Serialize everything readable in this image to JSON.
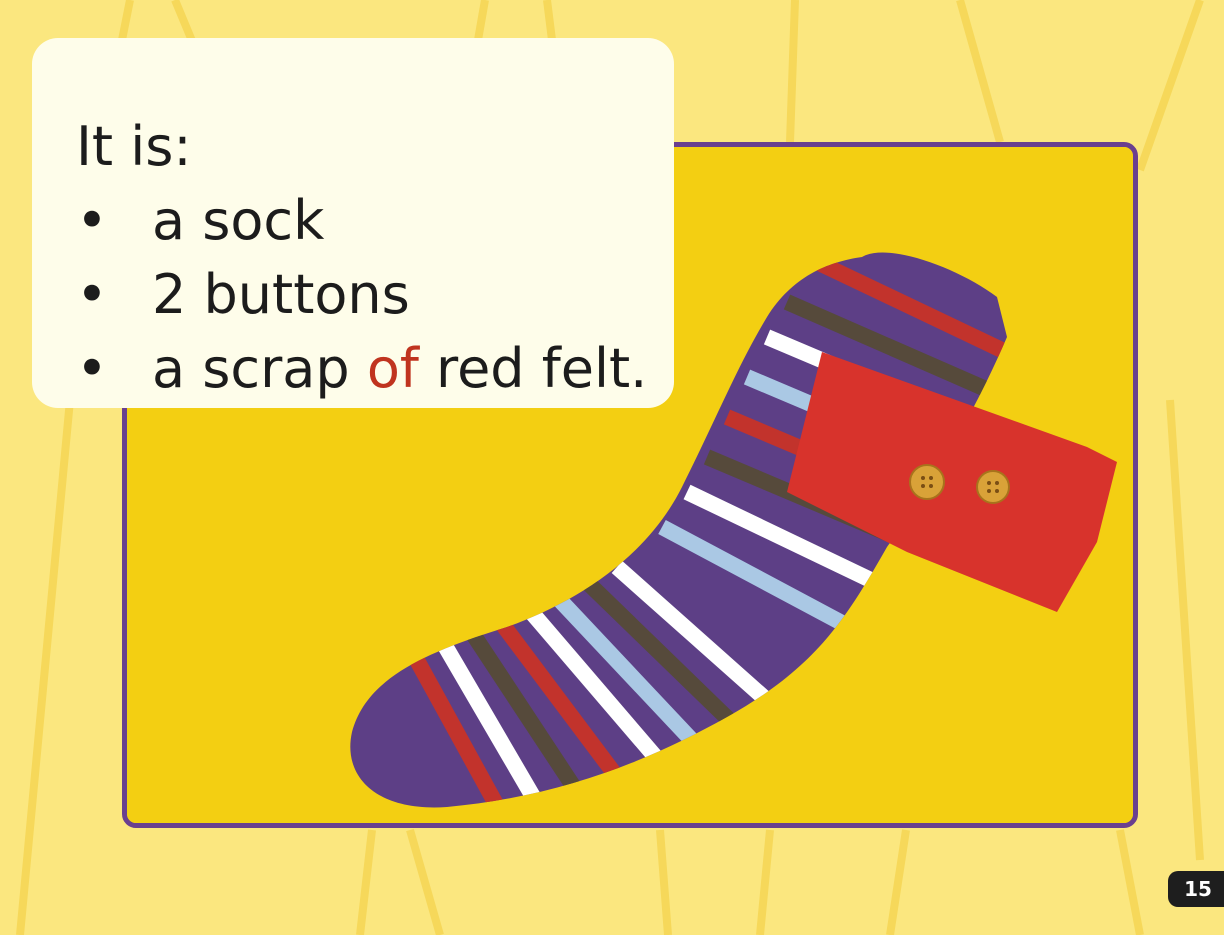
{
  "card": {
    "intro": "It is:",
    "items": [
      {
        "bullet": "•",
        "text": "a sock"
      },
      {
        "bullet": "•",
        "text": "2 buttons"
      },
      {
        "bullet": "•",
        "before": "a scrap ",
        "highlight": "of",
        "after": " red felt."
      }
    ]
  },
  "photo": {
    "subject": "striped purple sock with red felt scrap and two buttons on yellow background"
  },
  "footer": {
    "page_number": "15"
  },
  "colors": {
    "page_background": "#fbe77f",
    "frame_border": "#6a3f8f",
    "card_background": "#fefdea",
    "highlight_text": "#c0341f",
    "photo_background": "#f3cf12"
  }
}
